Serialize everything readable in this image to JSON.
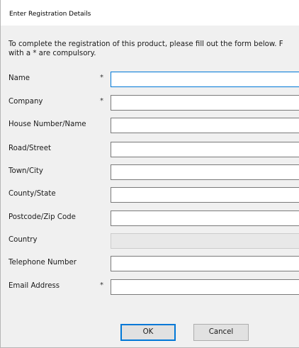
{
  "window": {
    "title": "Enter Registration Details"
  },
  "intro": {
    "line1": "To complete the registration of this product, please fill out the form below. F",
    "line2": "with a * are compulsory."
  },
  "required_marker": "*",
  "fields": [
    {
      "label": "Name",
      "required": true,
      "value": "",
      "focused": true,
      "disabled": false
    },
    {
      "label": "Company",
      "required": true,
      "value": "",
      "focused": false,
      "disabled": false
    },
    {
      "label": "House Number/Name",
      "required": false,
      "value": "",
      "focused": false,
      "disabled": false
    },
    {
      "label": "Road/Street",
      "required": false,
      "value": "",
      "focused": false,
      "disabled": false
    },
    {
      "label": "Town/City",
      "required": false,
      "value": "",
      "focused": false,
      "disabled": false
    },
    {
      "label": "County/State",
      "required": false,
      "value": "",
      "focused": false,
      "disabled": false
    },
    {
      "label": "Postcode/Zip Code",
      "required": false,
      "value": "",
      "focused": false,
      "disabled": false
    },
    {
      "label": "Country",
      "required": false,
      "value": "",
      "focused": false,
      "disabled": true
    },
    {
      "label": "Telephone Number",
      "required": false,
      "value": "",
      "focused": false,
      "disabled": false
    },
    {
      "label": "Email Address",
      "required": true,
      "value": "",
      "focused": false,
      "disabled": false
    }
  ],
  "buttons": {
    "ok_label": "OK",
    "cancel_label": "Cancel"
  },
  "colors": {
    "dialog_background": "#f0f0f0",
    "focus_border": "#0078d7",
    "disabled_field": "#e8e8e8"
  }
}
